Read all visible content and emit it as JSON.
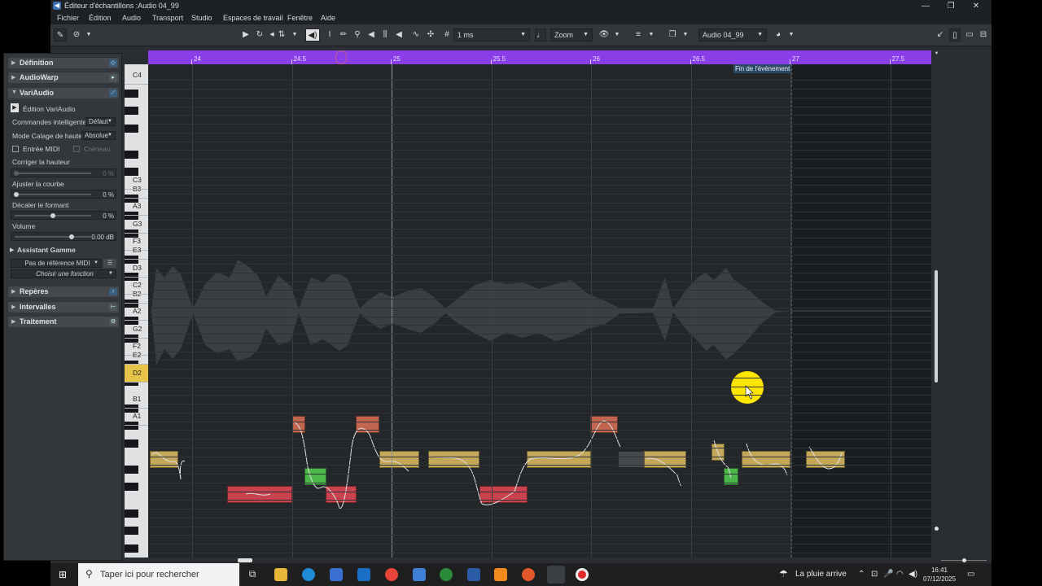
{
  "window": {
    "title": "Éditeur d'échantillons :Audio 04_99"
  },
  "menu": [
    "Fichier",
    "Édition",
    "Audio",
    "Transport",
    "Studio",
    "Espaces de travail",
    "Fenêtre",
    "Aide"
  ],
  "toolbar": {
    "quantize": "1 ms",
    "zoom": "Zoom",
    "event": "Audio 04_99"
  },
  "inspector": {
    "definition": "Définition",
    "audiowarp": "AudioWarp",
    "variaudio": "VariAudio",
    "edit_variaudio": "Édition VariAudio",
    "smart_controls_label": "Commandes intelligentes",
    "smart_controls_value": "Défaut",
    "pitch_snap_label": "Mode Calage de hauteur",
    "pitch_snap_value": "Absolue",
    "midi_input": "Entrée MIDI",
    "slot": "Créneau",
    "pitch_correct_label": "Corriger la hauteur",
    "pitch_correct_value": "0 %",
    "curve_label": "Ajuster la courbe",
    "curve_value": "0 %",
    "formant_label": "Décaler le formant",
    "formant_value": "0 %",
    "volume_label": "Volume",
    "volume_value": "0.00 dB",
    "scale_assistant": "Assistant Gamme",
    "midi_ref": "Pas de référence MIDI",
    "choose_function": "Choisir une fonction",
    "markers": "Repères",
    "ranges": "Intervalles",
    "processing": "Traitement"
  },
  "ruler": {
    "ticks": [
      {
        "label": "24",
        "x": 0
      },
      {
        "label": "24.5",
        "x": 0
      },
      {
        "label": "25",
        "x": 0
      },
      {
        "label": "25.5",
        "x": 0
      },
      {
        "label": "26",
        "x": 0
      },
      {
        "label": "26.5",
        "x": 0
      },
      {
        "label": "27",
        "x": 0
      },
      {
        "label": "27.5",
        "x": 0
      }
    ],
    "event_end": "Fin de l'événement"
  },
  "keyboard": {
    "labels": [
      "C4",
      "B3",
      "A3",
      "G3",
      "F3",
      "E3",
      "D3",
      "C3",
      "B2",
      "A2",
      "G2",
      "F2",
      "E2",
      "D2",
      "C2",
      "B1",
      "A1"
    ]
  },
  "taskbar": {
    "search_placeholder": "Taper ici pour rechercher",
    "weather": "La pluie arrive",
    "time": "16:41",
    "date": "07/12/2025"
  },
  "colors": {
    "ruler": "#8a3ee8",
    "note_d2": "#c4a85a",
    "note_c2": "#c9434f",
    "note_e2": "#c1654f",
    "note_cs2": "#4cb84a",
    "cursor": "#ffe600"
  }
}
